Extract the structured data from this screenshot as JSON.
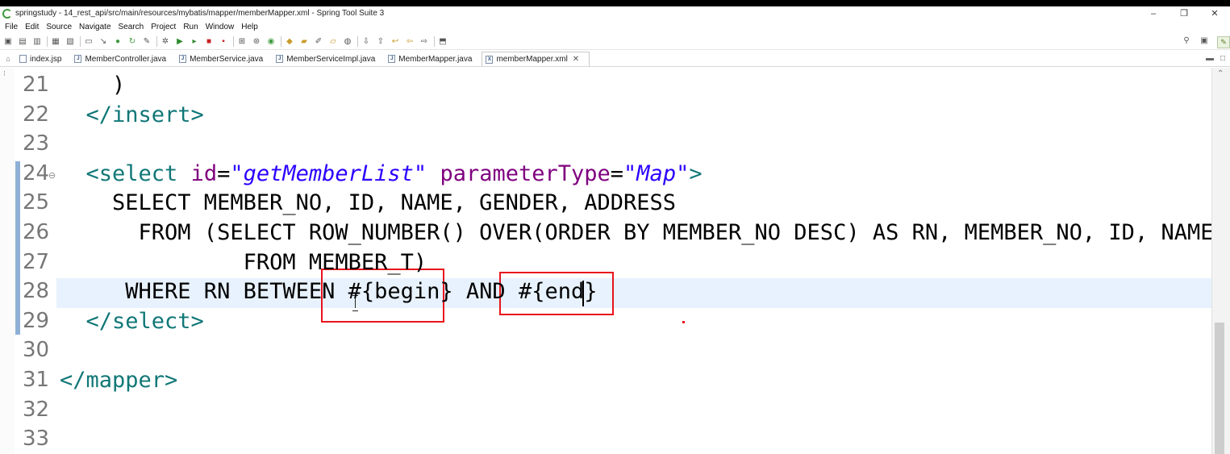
{
  "window": {
    "title": "springstudy - 14_rest_api/src/main/resources/mybatis/mapper/memberMapper.xml - Spring Tool Suite 3",
    "controls": {
      "minimize": "–",
      "restore": "❐",
      "close": "✕"
    }
  },
  "menu": [
    "File",
    "Edit",
    "Source",
    "Navigate",
    "Search",
    "Project",
    "Run",
    "Window",
    "Help"
  ],
  "tabs": [
    {
      "label": "index.jsp",
      "icon": "file-icon",
      "active": false
    },
    {
      "label": "MemberController.java",
      "icon": "java-file-icon",
      "active": false
    },
    {
      "label": "MemberService.java",
      "icon": "java-file-icon",
      "active": false
    },
    {
      "label": "MemberServiceImpl.java",
      "icon": "java-file-icon",
      "active": false
    },
    {
      "label": "MemberMapper.java",
      "icon": "java-file-icon",
      "active": false
    },
    {
      "label": "memberMapper.xml",
      "icon": "xml-file-icon",
      "active": true
    }
  ],
  "editor": {
    "lines": [
      {
        "num": "21",
        "segments": [
          {
            "t": "    )",
            "c": ""
          }
        ]
      },
      {
        "num": "22",
        "segments": [
          {
            "t": "  </insert>",
            "c": "tag"
          }
        ]
      },
      {
        "num": "23",
        "segments": []
      },
      {
        "num": "24",
        "fold": "⊖",
        "segments": [
          {
            "t": "  <select ",
            "c": "tag"
          },
          {
            "t": "id",
            "c": "attr"
          },
          {
            "t": "=",
            "c": ""
          },
          {
            "t": "\"getMemberList\"",
            "c": "val"
          },
          {
            "t": " ",
            "c": ""
          },
          {
            "t": "parameterType",
            "c": "attr"
          },
          {
            "t": "=",
            "c": ""
          },
          {
            "t": "\"Map\"",
            "c": "val"
          },
          {
            "t": ">",
            "c": "tag"
          }
        ]
      },
      {
        "num": "25",
        "segments": [
          {
            "t": "    SELECT MEMBER_NO, ID, NAME, GENDER, ADDRESS",
            "c": ""
          }
        ]
      },
      {
        "num": "26",
        "segments": [
          {
            "t": "      FROM (SELECT ROW_NUMBER() OVER(ORDER BY MEMBER_NO DESC) AS RN, MEMBER_NO, ID, NAME,",
            "c": ""
          }
        ]
      },
      {
        "num": "27",
        "segments": [
          {
            "t": "              FROM MEMBER_T)",
            "c": ""
          }
        ]
      },
      {
        "num": "28",
        "segments": [
          {
            "t": "     WHERE RN BETWEEN #{begin} AND #{end}",
            "c": ""
          }
        ]
      },
      {
        "num": "29",
        "segments": [
          {
            "t": "  </select>",
            "c": "tag"
          }
        ]
      },
      {
        "num": "30",
        "segments": []
      },
      {
        "num": "31",
        "segments": [
          {
            "t": "</mapper>",
            "c": "tag"
          }
        ]
      },
      {
        "num": "32",
        "segments": []
      },
      {
        "num": "33",
        "segments": []
      }
    ]
  },
  "colors": {
    "tag": "#117777",
    "attribute": "#7f007f",
    "attribute_value": "#2a00ff",
    "current_line": "#e8f2fe",
    "highlight_box": "#e8141c"
  }
}
